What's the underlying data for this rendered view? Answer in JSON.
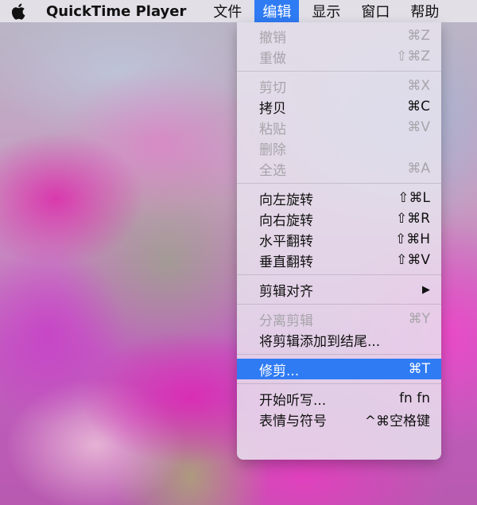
{
  "menubar": {
    "app_name": "QuickTime Player",
    "menus": [
      "文件",
      "编辑",
      "显示",
      "窗口",
      "帮助"
    ]
  },
  "edit_menu": {
    "items": [
      {
        "label": "撤销",
        "shortcut": "⌘Z",
        "enabled": false
      },
      {
        "label": "重做",
        "shortcut": "⇧⌘Z",
        "enabled": false
      },
      {
        "label": "剪切",
        "shortcut": "⌘X",
        "enabled": false
      },
      {
        "label": "拷贝",
        "shortcut": "⌘C",
        "enabled": true
      },
      {
        "label": "粘贴",
        "shortcut": "⌘V",
        "enabled": false
      },
      {
        "label": "删除",
        "shortcut": "",
        "enabled": false
      },
      {
        "label": "全选",
        "shortcut": "⌘A",
        "enabled": false
      },
      {
        "label": "向左旋转",
        "shortcut": "⇧⌘L",
        "enabled": true
      },
      {
        "label": "向右旋转",
        "shortcut": "⇧⌘R",
        "enabled": true
      },
      {
        "label": "水平翻转",
        "shortcut": "⇧⌘H",
        "enabled": true
      },
      {
        "label": "垂直翻转",
        "shortcut": "⇧⌘V",
        "enabled": true
      },
      {
        "label": "剪辑对齐",
        "shortcut": "▶",
        "enabled": true
      },
      {
        "label": "分离剪辑",
        "shortcut": "⌘Y",
        "enabled": false
      },
      {
        "label": "将剪辑添加到结尾...",
        "shortcut": "",
        "enabled": true
      },
      {
        "label": "修剪...",
        "shortcut": "⌘T",
        "enabled": true,
        "selected": true
      },
      {
        "label": "开始听写...",
        "shortcut": "fn fn",
        "enabled": true
      },
      {
        "label": "表情与符号",
        "shortcut": "^⌘空格键",
        "enabled": true
      }
    ]
  },
  "colors": {
    "accent": "#2f7bf4",
    "disabled_text": "#a7a4aa"
  }
}
